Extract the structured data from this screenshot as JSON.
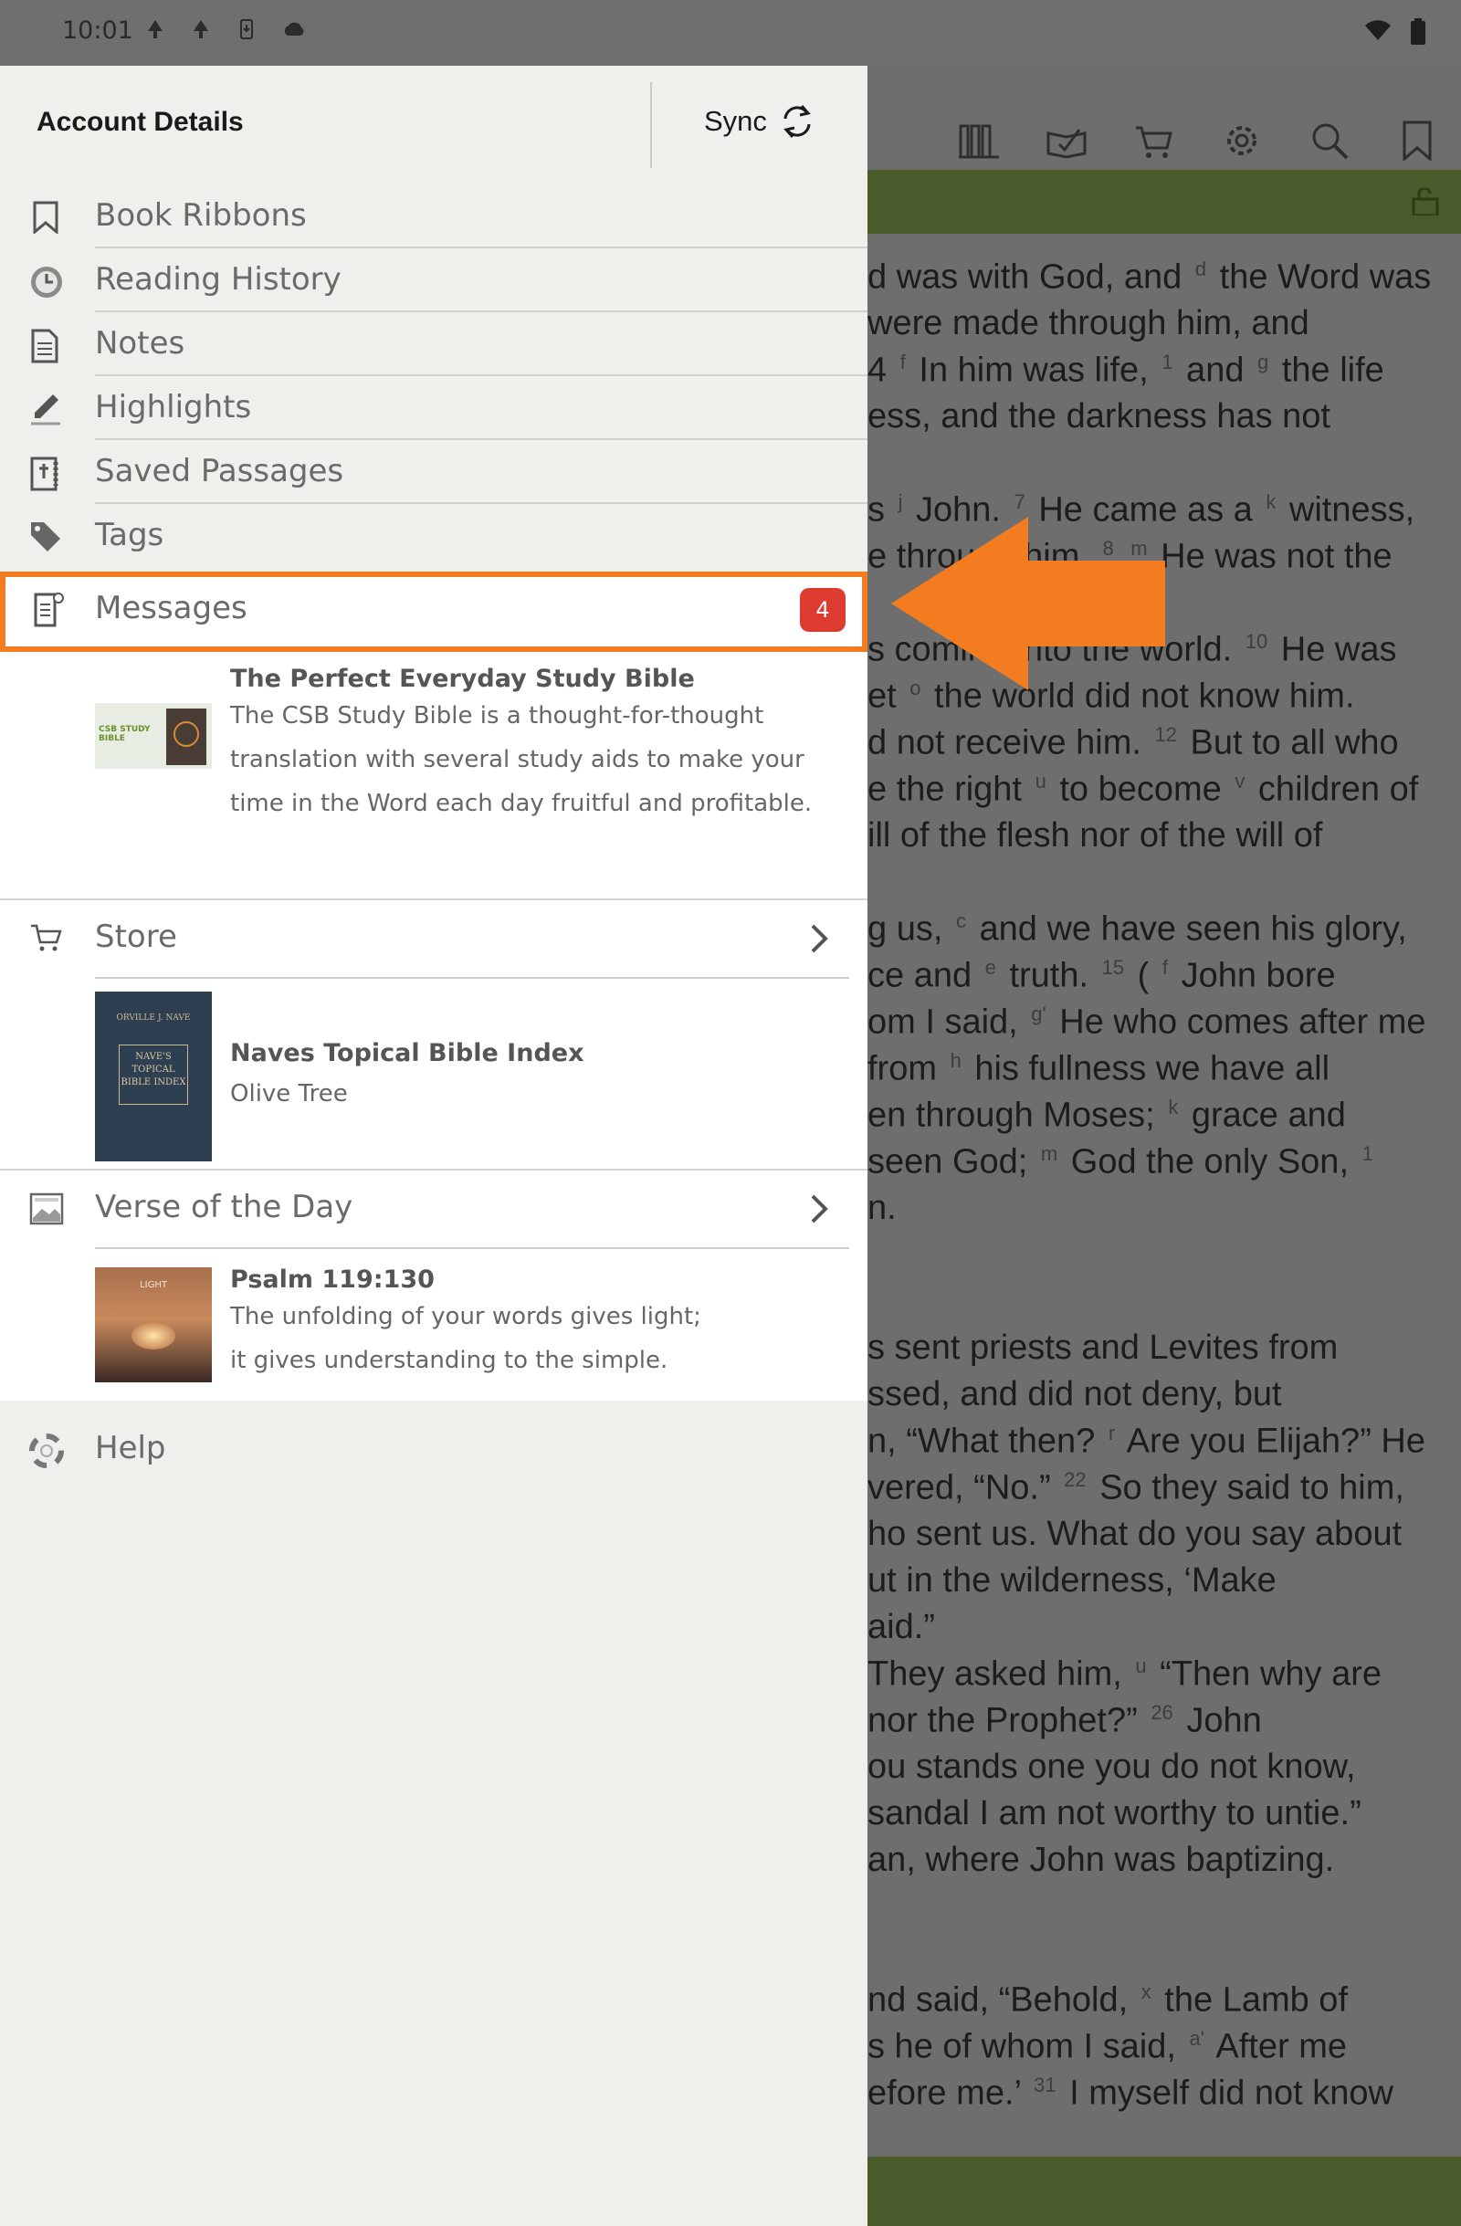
{
  "status_bar": {
    "time": "10:01"
  },
  "drawer": {
    "account_title": "Account Details",
    "sync_label": "Sync",
    "items": [
      {
        "label": "Book Ribbons",
        "icon": "bookmark-icon"
      },
      {
        "label": "Reading History",
        "icon": "clock-icon"
      },
      {
        "label": "Notes",
        "icon": "notes-icon"
      },
      {
        "label": "Highlights",
        "icon": "highlighter-icon"
      },
      {
        "label": "Saved Passages",
        "icon": "bible-icon"
      },
      {
        "label": "Tags",
        "icon": "tag-icon"
      }
    ],
    "messages": {
      "label": "Messages",
      "badge": "4",
      "icon": "messages-icon"
    },
    "message_card": {
      "title": "The Perfect Everyday Study Bible",
      "body": "The CSB Study Bible is a thought-for-thought translation with several study aids to make your time in the Word each day fruitful and profitable.",
      "thumb_text": "CSB STUDY BIBLE"
    },
    "store": {
      "label": "Store",
      "card_title": "Naves Topical Bible Index",
      "card_subtitle": "Olive Tree",
      "cover_author": "ORVILLE J. NAVE",
      "cover_title": "NAVE'S TOPICAL BIBLE INDEX"
    },
    "votd": {
      "label": "Verse of the Day",
      "card_title": "Psalm 119:130",
      "card_body": "The unfolding of your words gives light; it gives understanding to the simple.",
      "thumb_text": "LIGHT"
    },
    "help_label": "Help"
  },
  "reader": {
    "lines": [
      "d was with God, and |d| the Word was",
      " were made through him, and",
      "4 |f| In him was life, |1| and |g| the life",
      "ess, and the darkness has not",
      "",
      "s |j| John. |7| He came as a |k| witness,",
      "e through him. |8| |m| He was not the",
      "",
      "s coming into the world. |10| He was",
      "et |o| the world did not know him.",
      "d not receive him. |12| But to all who",
      "e the right |u| to become |v| children of",
      "ill of the flesh nor of the will of",
      "",
      "g us, |c| and we have seen his glory,",
      "ce and |e| truth. |15| ( |f| John bore",
      "om I said, |g'| He who comes after me",
      "from |h| his fullness we have all",
      "en through Moses; |k| grace and",
      "seen God; |m| God the only Son, |1|",
      "n.",
      "",
      "",
      "s sent priests and Levites from",
      "ssed, and did not deny, but",
      "n, “What then? |r| Are you Elijah?” He",
      "vered, “No.” |22| So they said to him,",
      "ho sent us. What do you say about",
      "ut in the wilderness, ‘Make",
      "aid.”",
      "They asked him, |u| “Then why are",
      " nor the Prophet?” |26| John",
      "ou stands one you do not know,",
      "sandal I am not worthy to untie.”",
      "an, where John was baptizing.",
      "",
      "",
      "nd said, “Behold, |x| the Lamb of",
      "s he of whom I said, |a'| After me",
      "efore me.’ |31| I myself did not know"
    ]
  },
  "colors": {
    "accent_orange": "#f47c20",
    "badge_red": "#dd3b2f",
    "header_green": "#4b5a2a",
    "drawer_bg": "#efefec"
  }
}
